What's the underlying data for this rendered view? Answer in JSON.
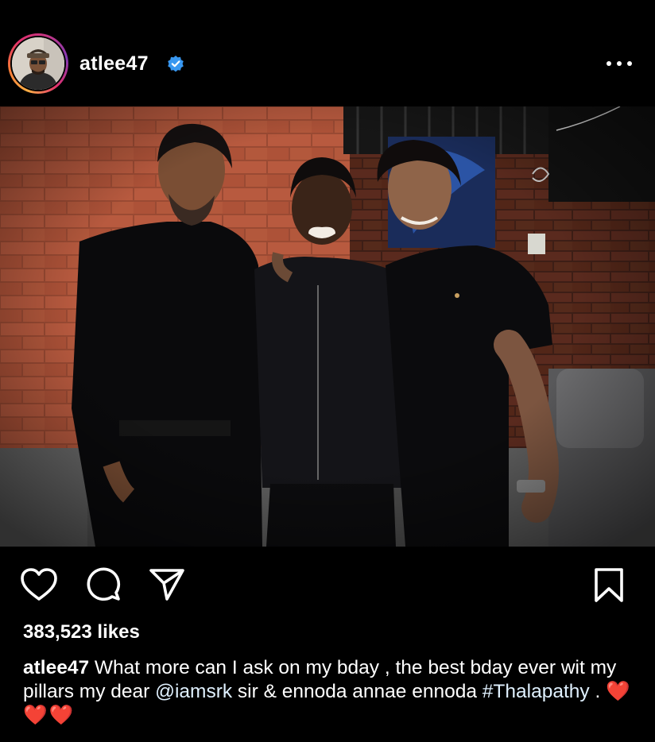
{
  "post": {
    "username": "atlee47",
    "verified": true,
    "likes_text": "383,523 likes",
    "caption": {
      "username": "atlee47",
      "part1": " What more can I ask on my bday , the best bday ever wit my pillars my  dear  ",
      "mention": "@iamsrk",
      "part2": " sir & ennoda annae ennoda ",
      "hashtag": "#Thalapathy",
      "part3": " . ",
      "emoji": "❤️❤️❤️"
    }
  },
  "icons": {
    "like": "heart-outline-icon",
    "comment": "comment-bubble-icon",
    "share": "paper-plane-icon",
    "save": "bookmark-icon",
    "more": "more-horizontal-icon",
    "verified": "verified-badge-icon"
  },
  "colors": {
    "background": "#000000",
    "text": "#ffffff",
    "verified": "#3897f0",
    "link": "#e0f1ff"
  }
}
